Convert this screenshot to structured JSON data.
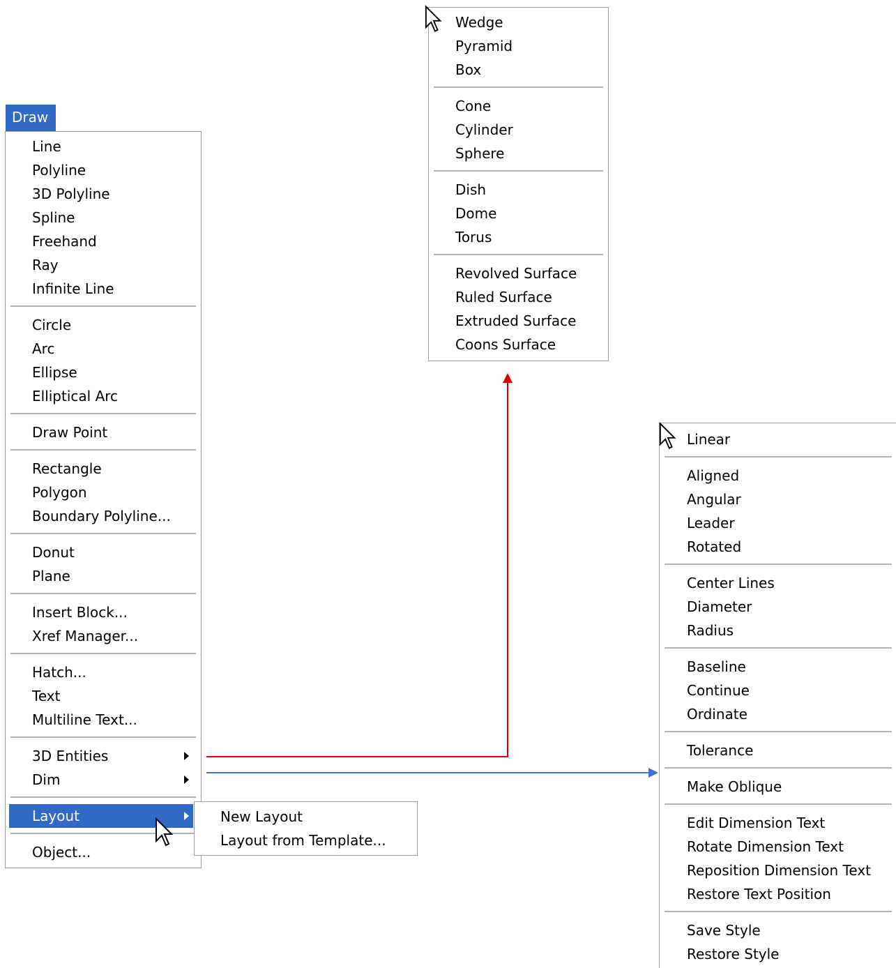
{
  "draw_menu": {
    "title": "Draw",
    "items": [
      {
        "label": "Line"
      },
      {
        "label": "Polyline"
      },
      {
        "label": "3D Polyline"
      },
      {
        "label": "Spline"
      },
      {
        "label": "Freehand"
      },
      {
        "label": "Ray"
      },
      {
        "label": "Infinite Line"
      },
      {
        "label": "Circle"
      },
      {
        "label": "Arc"
      },
      {
        "label": "Ellipse"
      },
      {
        "label": "Elliptical Arc"
      },
      {
        "label": "Draw Point"
      },
      {
        "label": "Rectangle"
      },
      {
        "label": "Polygon"
      },
      {
        "label": "Boundary Polyline..."
      },
      {
        "label": "Donut"
      },
      {
        "label": "Plane"
      },
      {
        "label": "Insert Block..."
      },
      {
        "label": "Xref Manager..."
      },
      {
        "label": "Hatch..."
      },
      {
        "label": "Text"
      },
      {
        "label": "Multiline Text..."
      },
      {
        "label": "3D Entities"
      },
      {
        "label": "Dim"
      },
      {
        "label": "Layout"
      },
      {
        "label": "Object..."
      }
    ]
  },
  "layout_submenu": {
    "items": [
      {
        "label": "New Layout"
      },
      {
        "label": "Layout from Template..."
      }
    ]
  },
  "entities_submenu": {
    "items": [
      {
        "label": "Wedge"
      },
      {
        "label": "Pyramid"
      },
      {
        "label": "Box"
      },
      {
        "label": "Cone"
      },
      {
        "label": "Cylinder"
      },
      {
        "label": "Sphere"
      },
      {
        "label": "Dish"
      },
      {
        "label": "Dome"
      },
      {
        "label": "Torus"
      },
      {
        "label": "Revolved Surface"
      },
      {
        "label": "Ruled Surface"
      },
      {
        "label": "Extruded Surface"
      },
      {
        "label": "Coons Surface"
      }
    ]
  },
  "dim_submenu": {
    "items": [
      {
        "label": "Linear"
      },
      {
        "label": "Aligned"
      },
      {
        "label": "Angular"
      },
      {
        "label": "Leader"
      },
      {
        "label": "Rotated"
      },
      {
        "label": "Center Lines"
      },
      {
        "label": "Diameter"
      },
      {
        "label": "Radius"
      },
      {
        "label": "Baseline"
      },
      {
        "label": "Continue"
      },
      {
        "label": "Ordinate"
      },
      {
        "label": "Tolerance"
      },
      {
        "label": "Make Oblique"
      },
      {
        "label": "Edit Dimension Text"
      },
      {
        "label": "Rotate Dimension Text"
      },
      {
        "label": "Reposition Dimension Text"
      },
      {
        "label": "Restore Text Position"
      },
      {
        "label": "Save Style"
      },
      {
        "label": "Restore Style"
      }
    ]
  },
  "colors": {
    "highlight": "#3169c6",
    "entities_connector": "#e00000",
    "dim_connector": "#3a6fe0"
  }
}
